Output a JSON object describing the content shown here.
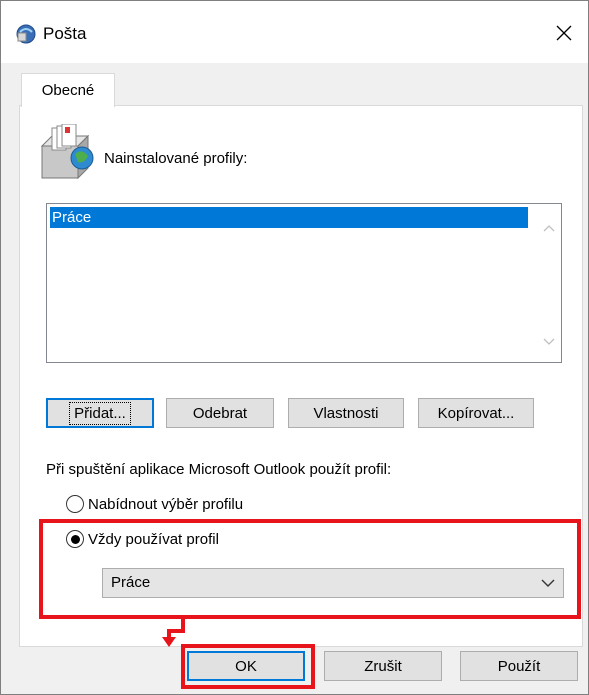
{
  "window": {
    "title": "Pošta"
  },
  "tabs": [
    {
      "label": "Obecné"
    }
  ],
  "general": {
    "profiles_label": "Nainstalované profily:",
    "profiles": [
      "Práce"
    ],
    "selected_profile_index": 0,
    "buttons": {
      "add": "Přidat...",
      "remove": "Odebrat",
      "properties": "Vlastnosti",
      "copy": "Kopírovat..."
    },
    "startup_label": "Při spuštění aplikace Microsoft Outlook použít profil:",
    "options": {
      "prompt": "Nabídnout výběr profilu",
      "always": "Vždy používat profil"
    },
    "selected_option": "always",
    "always_profile_value": "Práce"
  },
  "footer": {
    "ok": "OK",
    "cancel": "Zrušit",
    "apply": "Použít"
  },
  "colors": {
    "annotation": "#e8141b",
    "selection": "#0078d7"
  }
}
